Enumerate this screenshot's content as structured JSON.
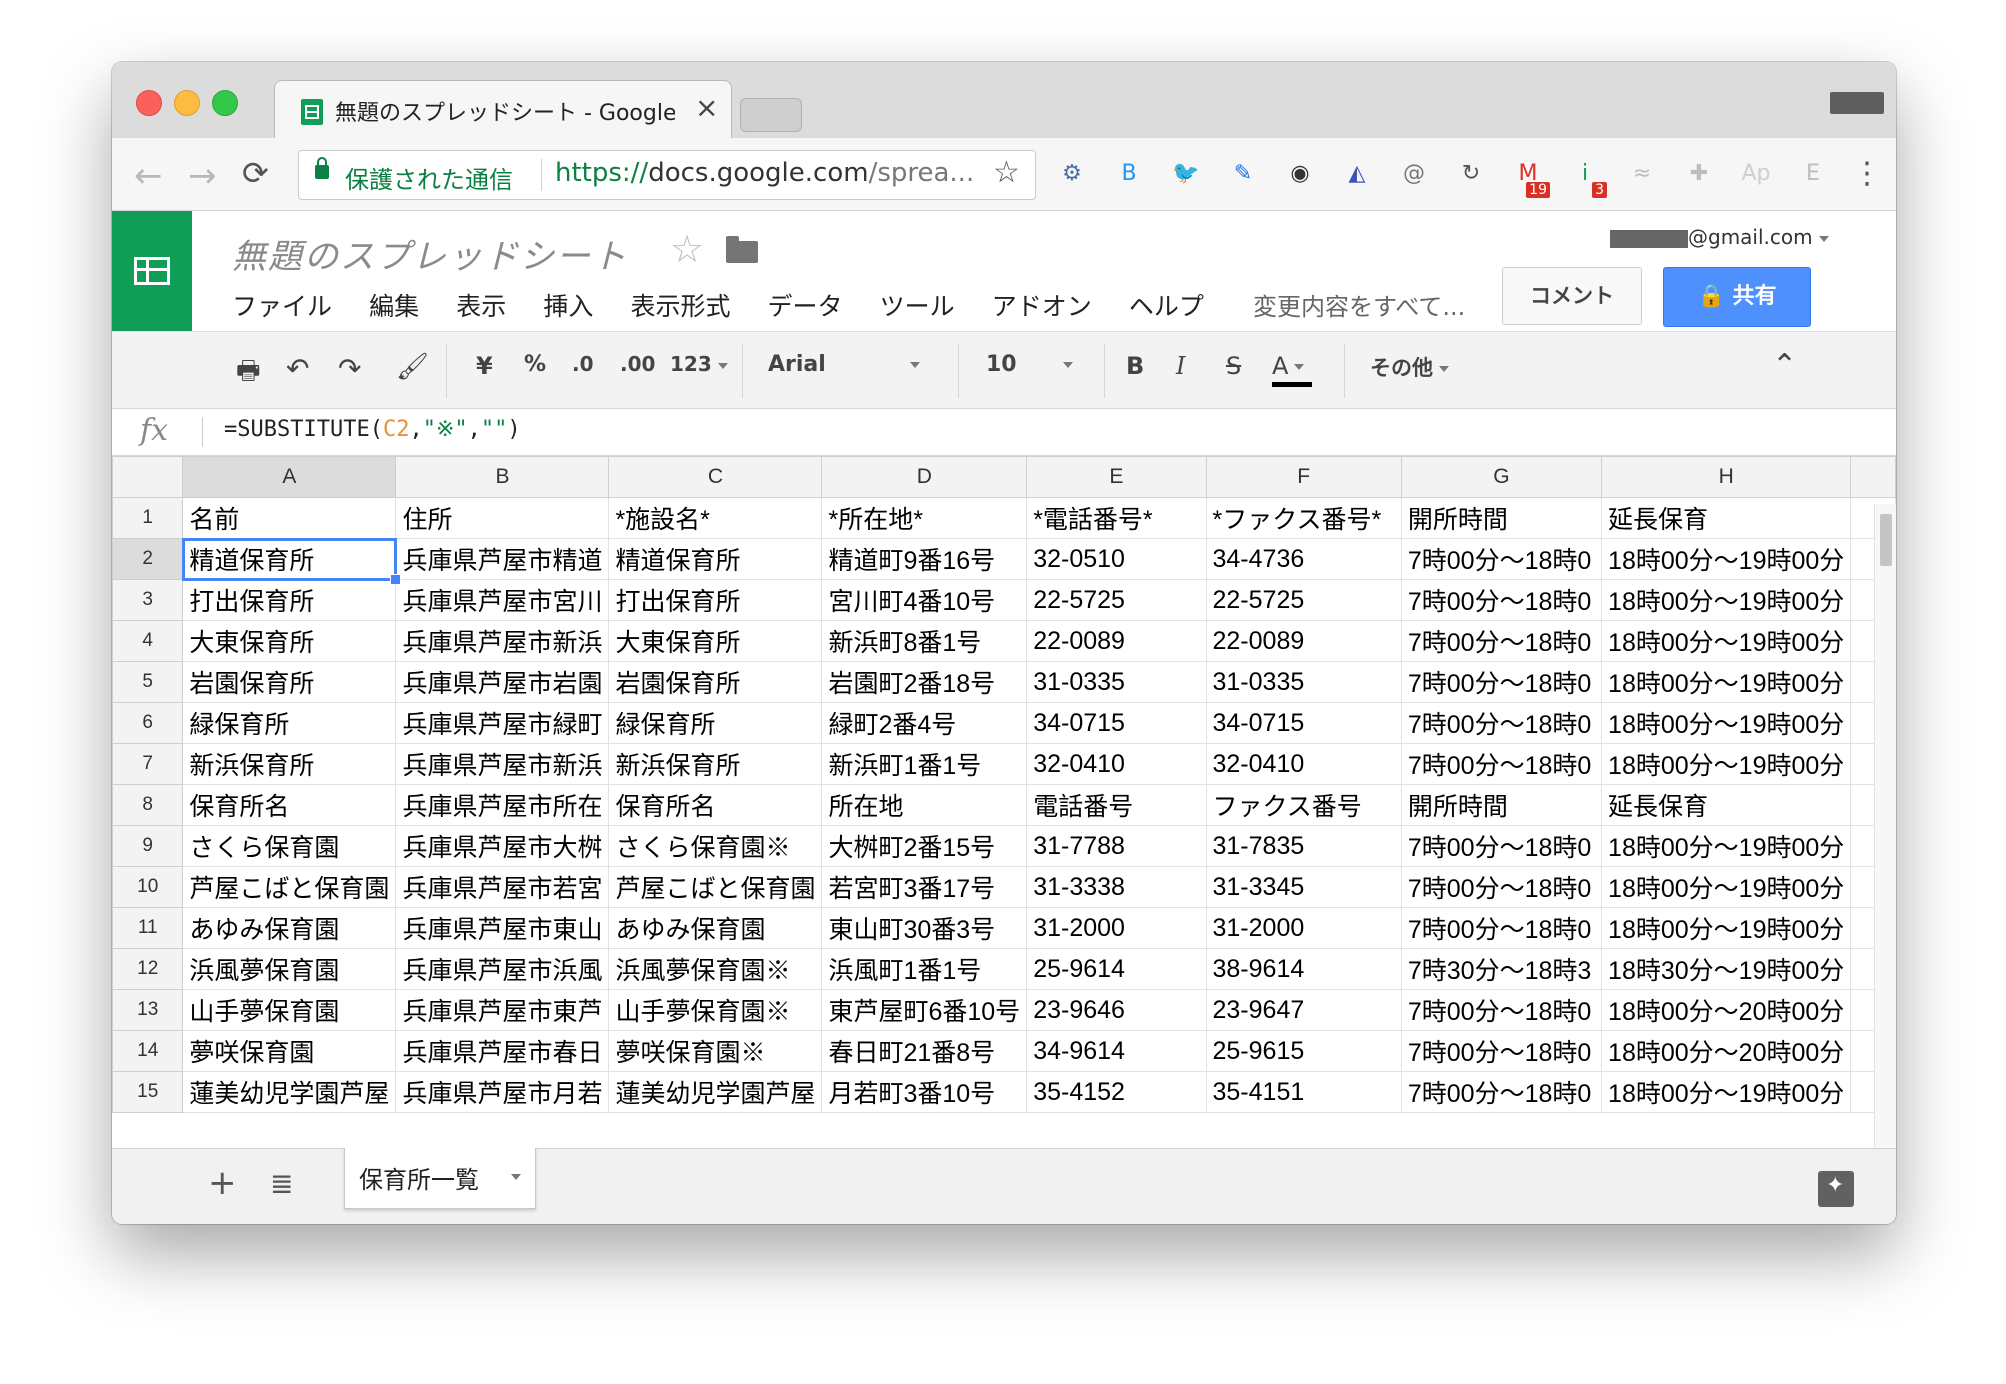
{
  "browser": {
    "tab_title": "無題のスプレッドシート - Google",
    "tab_close": "×",
    "secure_label": "保護された通信",
    "url_scheme": "https://",
    "url_host": "docs.google.com",
    "url_rest": "/sprea...",
    "nav_back": "←",
    "nav_forward": "→",
    "nav_reload": "⟳",
    "star": "☆",
    "menu": "⋮",
    "extensions": [
      {
        "name": "gear-extension-icon",
        "glyph": "⚙",
        "color": "#4a6fa5"
      },
      {
        "name": "blog-extension-icon",
        "glyph": "B",
        "color": "#2196f3"
      },
      {
        "name": "twitter-icon",
        "glyph": "🐦",
        "color": "#55acee"
      },
      {
        "name": "eyedropper-icon",
        "glyph": "✎",
        "color": "#1a73e8"
      },
      {
        "name": "color-wheel-icon",
        "glyph": "◉",
        "color": "#333333"
      },
      {
        "name": "speed-icon",
        "glyph": "◭",
        "color": "#3f51b5"
      },
      {
        "name": "note-icon",
        "glyph": "@",
        "color": "#777777"
      },
      {
        "name": "sync-icon",
        "glyph": "↻",
        "color": "#555555"
      },
      {
        "name": "gmail-icon",
        "glyph": "M",
        "color": "#d93025",
        "badge": "19"
      },
      {
        "name": "inbox-icon",
        "glyph": "i",
        "color": "#0f9d58",
        "badge": "3"
      },
      {
        "name": "rss-icon",
        "glyph": "≈",
        "color": "#bdbdbd"
      },
      {
        "name": "puzzle-icon",
        "glyph": "✚",
        "color": "#bdbdbd"
      },
      {
        "name": "ap-icon",
        "glyph": "Ap",
        "color": "#cfcfcf"
      },
      {
        "name": "e-icon",
        "glyph": "E",
        "color": "#bdbdbd"
      }
    ]
  },
  "docs": {
    "title": "無題のスプレッドシート",
    "account": "@gmail.com",
    "menus": [
      "ファイル",
      "編集",
      "表示",
      "挿入",
      "表示形式",
      "データ",
      "ツール",
      "アドオン",
      "ヘルプ"
    ],
    "last_edit": "変更内容をすべて...",
    "comment_label": "コメント",
    "share_label": "共有"
  },
  "toolbar": {
    "currency": "¥",
    "percent": "%",
    "dec_decrease": ".0",
    "dec_increase": ".00",
    "more_formats": "123",
    "font": "Arial",
    "font_size": "10",
    "bold": "B",
    "italic": "I",
    "strike": "S",
    "text_color": "A",
    "more": "その他",
    "collapse": "⌃"
  },
  "formula": {
    "fx": "fx",
    "prefix": "=SUBSTITUTE(",
    "ref": "C2",
    "rest_1": ",",
    "str1": "\"※\"",
    "rest_2": ",",
    "str2": "\"\"",
    "suffix": ")"
  },
  "grid": {
    "columns": [
      "A",
      "B",
      "C",
      "D",
      "E",
      "F",
      "G",
      "H"
    ],
    "rows": [
      {
        "n": "1",
        "cells": [
          "名前",
          "住所",
          "*施設名*",
          "*所在地*",
          "*電話番号*",
          "*ファクス番号*",
          "開所時間",
          "延長保育"
        ]
      },
      {
        "n": "2",
        "cells": [
          "精道保育所",
          "兵庫県芦屋市精道",
          "精道保育所",
          "精道町9番16号",
          "32-0510",
          "34-4736",
          "7時00分〜18時0",
          "18時00分〜19時00分"
        ]
      },
      {
        "n": "3",
        "cells": [
          "打出保育所",
          "兵庫県芦屋市宮川",
          "打出保育所",
          "宮川町4番10号",
          "22-5725",
          "22-5725",
          "7時00分〜18時0",
          "18時00分〜19時00分"
        ]
      },
      {
        "n": "4",
        "cells": [
          "大東保育所",
          "兵庫県芦屋市新浜",
          "大東保育所",
          "新浜町8番1号",
          "22-0089",
          "22-0089",
          "7時00分〜18時0",
          "18時00分〜19時00分"
        ]
      },
      {
        "n": "5",
        "cells": [
          "岩園保育所",
          "兵庫県芦屋市岩園",
          "岩園保育所",
          "岩園町2番18号",
          "31-0335",
          "31-0335",
          "7時00分〜18時0",
          "18時00分〜19時00分"
        ]
      },
      {
        "n": "6",
        "cells": [
          "緑保育所",
          "兵庫県芦屋市緑町",
          "緑保育所",
          "緑町2番4号",
          "34-0715",
          "34-0715",
          "7時00分〜18時0",
          "18時00分〜19時00分"
        ]
      },
      {
        "n": "7",
        "cells": [
          "新浜保育所",
          "兵庫県芦屋市新浜",
          "新浜保育所",
          "新浜町1番1号",
          "32-0410",
          "32-0410",
          "7時00分〜18時0",
          "18時00分〜19時00分"
        ]
      },
      {
        "n": "8",
        "cells": [
          "保育所名",
          "兵庫県芦屋市所在",
          "保育所名",
          "所在地",
          "電話番号",
          "ファクス番号",
          "開所時間",
          "延長保育"
        ]
      },
      {
        "n": "9",
        "cells": [
          "さくら保育園",
          "兵庫県芦屋市大桝",
          "さくら保育園※",
          "大桝町2番15号",
          "31-7788",
          "31-7835",
          "7時00分〜18時0",
          "18時00分〜19時00分"
        ]
      },
      {
        "n": "10",
        "cells": [
          "芦屋こばと保育園",
          "兵庫県芦屋市若宮",
          "芦屋こばと保育園",
          "若宮町3番17号",
          "31-3338",
          "31-3345",
          "7時00分〜18時0",
          "18時00分〜19時00分"
        ]
      },
      {
        "n": "11",
        "cells": [
          "あゆみ保育園",
          "兵庫県芦屋市東山",
          "あゆみ保育園",
          "東山町30番3号",
          "31-2000",
          "31-2000",
          "7時00分〜18時0",
          "18時00分〜19時00分"
        ]
      },
      {
        "n": "12",
        "cells": [
          "浜風夢保育園",
          "兵庫県芦屋市浜風",
          "浜風夢保育園※",
          "浜風町1番1号",
          "25-9614",
          "38-9614",
          "7時30分〜18時3",
          "18時30分〜19時00分"
        ]
      },
      {
        "n": "13",
        "cells": [
          "山手夢保育園",
          "兵庫県芦屋市東芦",
          "山手夢保育園※",
          "東芦屋町6番10号",
          "23-9646",
          "23-9647",
          "7時00分〜18時0",
          "18時00分〜20時00分"
        ]
      },
      {
        "n": "14",
        "cells": [
          "夢咲保育園",
          "兵庫県芦屋市春日",
          "夢咲保育園※",
          "春日町21番8号",
          "34-9614",
          "25-9615",
          "7時00分〜18時0",
          "18時00分〜20時00分"
        ]
      },
      {
        "n": "15",
        "cells": [
          "蓮美幼児学園芦屋",
          "兵庫県芦屋市月若",
          "蓮美幼児学園芦屋",
          "月若町3番10号",
          "35-4152",
          "35-4151",
          "7時00分〜18時0",
          "18時00分〜19時00分"
        ]
      }
    ]
  },
  "sheetbar": {
    "add": "+",
    "list": "≣",
    "sheet_name": "保育所一覧"
  }
}
